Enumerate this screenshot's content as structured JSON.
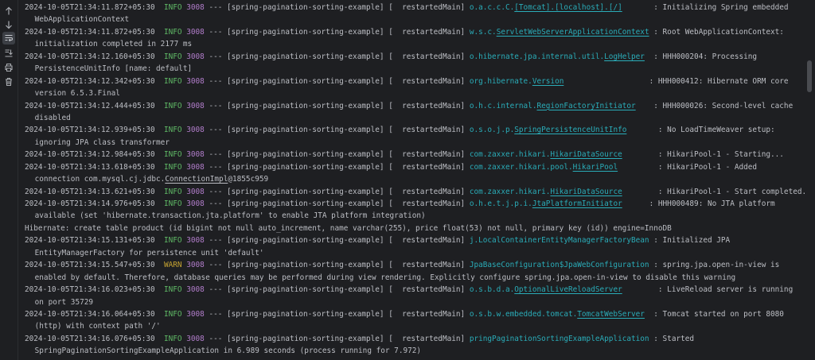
{
  "toolbar": {
    "icons": [
      "up-arrow-icon",
      "down-arrow-icon",
      "soft-wrap-icon",
      "scroll-to-end-icon",
      "print-icon",
      "trash-icon"
    ]
  },
  "colors": {
    "background": "#1e1f22",
    "info": "#5fb865",
    "warn": "#c5a332",
    "pid": "#b07cc9",
    "logger": "#2aacb8",
    "text": "#bcbec4"
  },
  "console": {
    "lines": [
      {
        "ts": "2024-10-05T21:34:11.872+05:30",
        "lvl": "INFO",
        "pid": "3008",
        "sep": " --- [spring-pagination-sorting-example] [  restartedMain] ",
        "lg_pre": "o.a.c.c.C.",
        "lg_u": "[Tomcat].[localhost].[/]",
        "lg_post": "",
        "pad": "       ",
        "msg": ": Initializing Spring embedded"
      },
      {
        "cont": " WebApplicationContext"
      },
      {
        "ts": "2024-10-05T21:34:11.872+05:30",
        "lvl": "INFO",
        "pid": "3008",
        "sep": " --- [spring-pagination-sorting-example] [  restartedMain] ",
        "lg_pre": "w.s.c.",
        "lg_u": "ServletWebServerApplicationContext",
        "lg_post": "",
        "pad": " ",
        "msg": ": Root WebApplicationContext:"
      },
      {
        "cont": " initialization completed in 2177 ms"
      },
      {
        "ts": "2024-10-05T21:34:12.160+05:30",
        "lvl": "INFO",
        "pid": "3008",
        "sep": " --- [spring-pagination-sorting-example] [  restartedMain] ",
        "lg_pre": "o.hibernate.jpa.internal.util.",
        "lg_u": "LogHelper",
        "lg_post": "",
        "pad": "  ",
        "msg": ": HHH000204: Processing"
      },
      {
        "cont": " PersistenceUnitInfo [name: default]"
      },
      {
        "ts": "2024-10-05T21:34:12.342+05:30",
        "lvl": "INFO",
        "pid": "3008",
        "sep": " --- [spring-pagination-sorting-example] [  restartedMain] ",
        "lg_pre": "org.hibernate.",
        "lg_u": "Version",
        "lg_post": "",
        "pad": "                   ",
        "msg": ": HHH000412: Hibernate ORM core"
      },
      {
        "cont": " version 6.5.3.Final"
      },
      {
        "ts": "2024-10-05T21:34:12.444+05:30",
        "lvl": "INFO",
        "pid": "3008",
        "sep": " --- [spring-pagination-sorting-example] [  restartedMain] ",
        "lg_pre": "o.h.c.internal.",
        "lg_u": "RegionFactoryInitiator",
        "lg_post": "",
        "pad": "    ",
        "msg": ": HHH000026: Second-level cache"
      },
      {
        "cont": " disabled"
      },
      {
        "ts": "2024-10-05T21:34:12.939+05:30",
        "lvl": "INFO",
        "pid": "3008",
        "sep": " --- [spring-pagination-sorting-example] [  restartedMain] ",
        "lg_pre": "o.s.o.j.p.",
        "lg_u": "SpringPersistenceUnitInfo",
        "lg_post": "",
        "pad": "       ",
        "msg": ": No LoadTimeWeaver setup:"
      },
      {
        "cont": " ignoring JPA class transformer"
      },
      {
        "ts": "2024-10-05T21:34:12.984+05:30",
        "lvl": "INFO",
        "pid": "3008",
        "sep": " --- [spring-pagination-sorting-example] [  restartedMain] ",
        "lg_pre": "com.zaxxer.hikari.",
        "lg_u": "HikariDataSource",
        "lg_post": "",
        "pad": "        ",
        "msg": ": HikariPool-1 - Starting..."
      },
      {
        "ts": "2024-10-05T21:34:13.618+05:30",
        "lvl": "INFO",
        "pid": "3008",
        "sep": " --- [spring-pagination-sorting-example] [  restartedMain] ",
        "lg_pre": "com.zaxxer.hikari.pool.",
        "lg_u": "HikariPool",
        "lg_post": "",
        "pad": "         ",
        "msg": ": HikariPool-1 - Added"
      },
      {
        "cont": " connection com.mysql.cj.jdbc.",
        "cont_u": "ConnectionImpl",
        "cont_post": "@1855c959"
      },
      {
        "ts": "2024-10-05T21:34:13.621+05:30",
        "lvl": "INFO",
        "pid": "3008",
        "sep": " --- [spring-pagination-sorting-example] [  restartedMain] ",
        "lg_pre": "com.zaxxer.hikari.",
        "lg_u": "HikariDataSource",
        "lg_post": "",
        "pad": "        ",
        "msg": ": HikariPool-1 - Start completed."
      },
      {
        "ts": "2024-10-05T21:34:14.976+05:30",
        "lvl": "INFO",
        "pid": "3008",
        "sep": " --- [spring-pagination-sorting-example] [  restartedMain] ",
        "lg_pre": "o.h.e.t.j.p.i.",
        "lg_u": "JtaPlatformInitiator",
        "lg_post": "",
        "pad": "      ",
        "msg": ": HHH000489: No JTA platform"
      },
      {
        "cont": " available (set 'hibernate.transaction.jta.platform' to enable JTA platform integration)"
      },
      {
        "plain": "Hibernate: create table product (id bigint not null auto_increment, name varchar(255), price float(53) not null, primary key (id)) engine=InnoDB"
      },
      {
        "ts": "2024-10-05T21:34:15.131+05:30",
        "lvl": "INFO",
        "pid": "3008",
        "sep": " --- [spring-pagination-sorting-example] [  restartedMain] ",
        "lg_pre": "j.LocalContainerEntityManagerFactoryBean",
        "lg_u": "",
        "lg_post": "",
        "pad": " ",
        "msg": ": Initialized JPA"
      },
      {
        "cont": " EntityManagerFactory for persistence unit 'default'"
      },
      {
        "ts": "2024-10-05T21:34:15.547+05:30",
        "lvl": "WARN",
        "pid": "3008",
        "sep": " --- [spring-pagination-sorting-example] [  restartedMain] ",
        "lg_pre": "JpaBaseConfiguration$JpaWebConfiguration",
        "lg_u": "",
        "lg_post": "",
        "pad": " ",
        "msg": ": spring.jpa.open-in-view is"
      },
      {
        "cont": " enabled by default. Therefore, database queries may be performed during view rendering. Explicitly configure spring.jpa.open-in-view to disable this warning"
      },
      {
        "ts": "2024-10-05T21:34:16.023+05:30",
        "lvl": "INFO",
        "pid": "3008",
        "sep": " --- [spring-pagination-sorting-example] [  restartedMain] ",
        "lg_pre": "o.s.b.d.a.",
        "lg_u": "OptionalLiveReloadServer",
        "lg_post": "",
        "pad": "        ",
        "msg": ": LiveReload server is running"
      },
      {
        "cont": " on port 35729"
      },
      {
        "ts": "2024-10-05T21:34:16.064+05:30",
        "lvl": "INFO",
        "pid": "3008",
        "sep": " --- [spring-pagination-sorting-example] [  restartedMain] ",
        "lg_pre": "o.s.b.w.embedded.tomcat.",
        "lg_u": "TomcatWebServer",
        "lg_post": "",
        "pad": "  ",
        "msg": ": Tomcat started on port 8080"
      },
      {
        "cont": " (http) with context path '/'"
      },
      {
        "ts": "2024-10-05T21:34:16.076+05:30",
        "lvl": "INFO",
        "pid": "3008",
        "sep": " --- [spring-pagination-sorting-example] [  restartedMain] ",
        "lg_pre": "pringPaginationSortingExampleApplication",
        "lg_u": "",
        "lg_post": "",
        "pad": " ",
        "msg": ": Started"
      },
      {
        "cont": " SpringPaginationSortingExampleApplication in 6.989 seconds (process running for 7.972)"
      }
    ]
  }
}
